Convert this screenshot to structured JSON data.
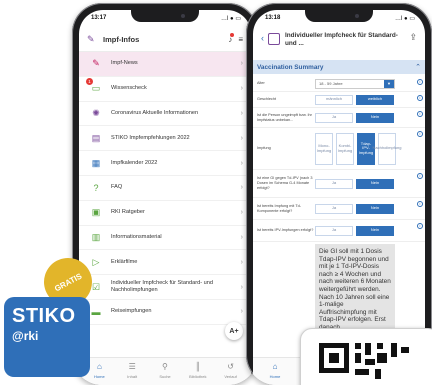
{
  "left_phone": {
    "status": {
      "time": "13:17",
      "signal": "…l ● ▭"
    },
    "header": {
      "title": "Impf-Infos",
      "brand_icon": "syringe-icon",
      "bell_icon": "bell-icon",
      "menu_icon": "hamburger-icon"
    },
    "menu": [
      {
        "label": "Impf-News",
        "icon": "syringe-icon",
        "highlight": true
      },
      {
        "label": "Wissenscheck",
        "icon": "chat-icon",
        "badge": "1"
      },
      {
        "label": "Coronavirus Aktuelle Informationen",
        "icon": "virus-icon"
      },
      {
        "label": "STIKO Impfempfehlungen 2022",
        "icon": "document-icon"
      },
      {
        "label": "Impfkalender 2022",
        "icon": "calendar-icon"
      },
      {
        "label": "FAQ",
        "icon": "faq-icon"
      },
      {
        "label": "RKI Ratgeber",
        "icon": "book-icon"
      },
      {
        "label": "Informationsmaterial",
        "icon": "folder-icon"
      },
      {
        "label": "Erklärfilme",
        "icon": "play-icon"
      },
      {
        "label": "Individueller Impfcheck für Standard- und Nachholimpfungen",
        "icon": "checklist-icon"
      },
      {
        "label": "Reiseimpfungen",
        "icon": "suitcase-icon"
      }
    ],
    "fab_label": "A+",
    "tabs": [
      {
        "label": "Home",
        "icon": "home-icon",
        "active": true
      },
      {
        "label": "Inhalt",
        "icon": "list-icon"
      },
      {
        "label": "Suche",
        "icon": "search-icon"
      },
      {
        "label": "Bibliothek",
        "icon": "library-icon"
      },
      {
        "label": "Verlauf",
        "icon": "history-icon"
      }
    ]
  },
  "right_phone": {
    "status": {
      "time": "13:18",
      "signal": "…l ● ▭"
    },
    "header": {
      "title": "Individueller Impfcheck für Standard- und ..."
    },
    "section_title": "Vaccination Summary",
    "form": {
      "age_label": "Alter",
      "age_value": "18 - 59 Jahre",
      "sex_label": "Geschlecht",
      "sex_options": [
        "männlich",
        "weiblich"
      ],
      "status_label": "Ist die Person ungeimpft bzw. ihr Impfstatus unbekan...",
      "status_options": [
        "Ja",
        "Nein"
      ],
      "vacc_label": "Impfung",
      "vacc_options": [
        "Mono-Impfung",
        "Kombi-Impfung",
        "Tdap-IPV-Impfung",
        "Nachholimpfung"
      ],
      "q1_label": "Ist eine GI gegen Td-IPV (nach 3 Dosen im Schema G-4 Monate erfolgt?",
      "q2_label": "Ist bereits Impfung mit Td-Komponente erfolgt?",
      "q3_label": "Ist bereits IPV-Impfungen erfolgt?",
      "yes_no": [
        "Ja",
        "Nein"
      ]
    },
    "result_text": "Die GI soll mit 1 Dosis Tdap-IPV begonnen und mit je 1 Td-IPV-Dosis nach ≥ 4 Wochen und nach weiteren 6 Monaten weitergeführt werden. Nach 10 Jahren soll eine 1-malige Auffrischimpfung mit Tdap-IPV erfolgen. Erst danach",
    "tabs": [
      {
        "label": "Home",
        "icon": "home-icon",
        "active": true
      },
      {
        "label": "Inhalt",
        "icon": "list-icon"
      }
    ]
  },
  "badge": {
    "title": "STIKO",
    "subtitle": "@rki",
    "sticker": "GRATIS"
  },
  "colors": {
    "accent": "#2f6fb8",
    "brand_purple": "#7a4a9a",
    "sticker_gold": "#e2b52a",
    "highlight": "#f7e6f0"
  }
}
